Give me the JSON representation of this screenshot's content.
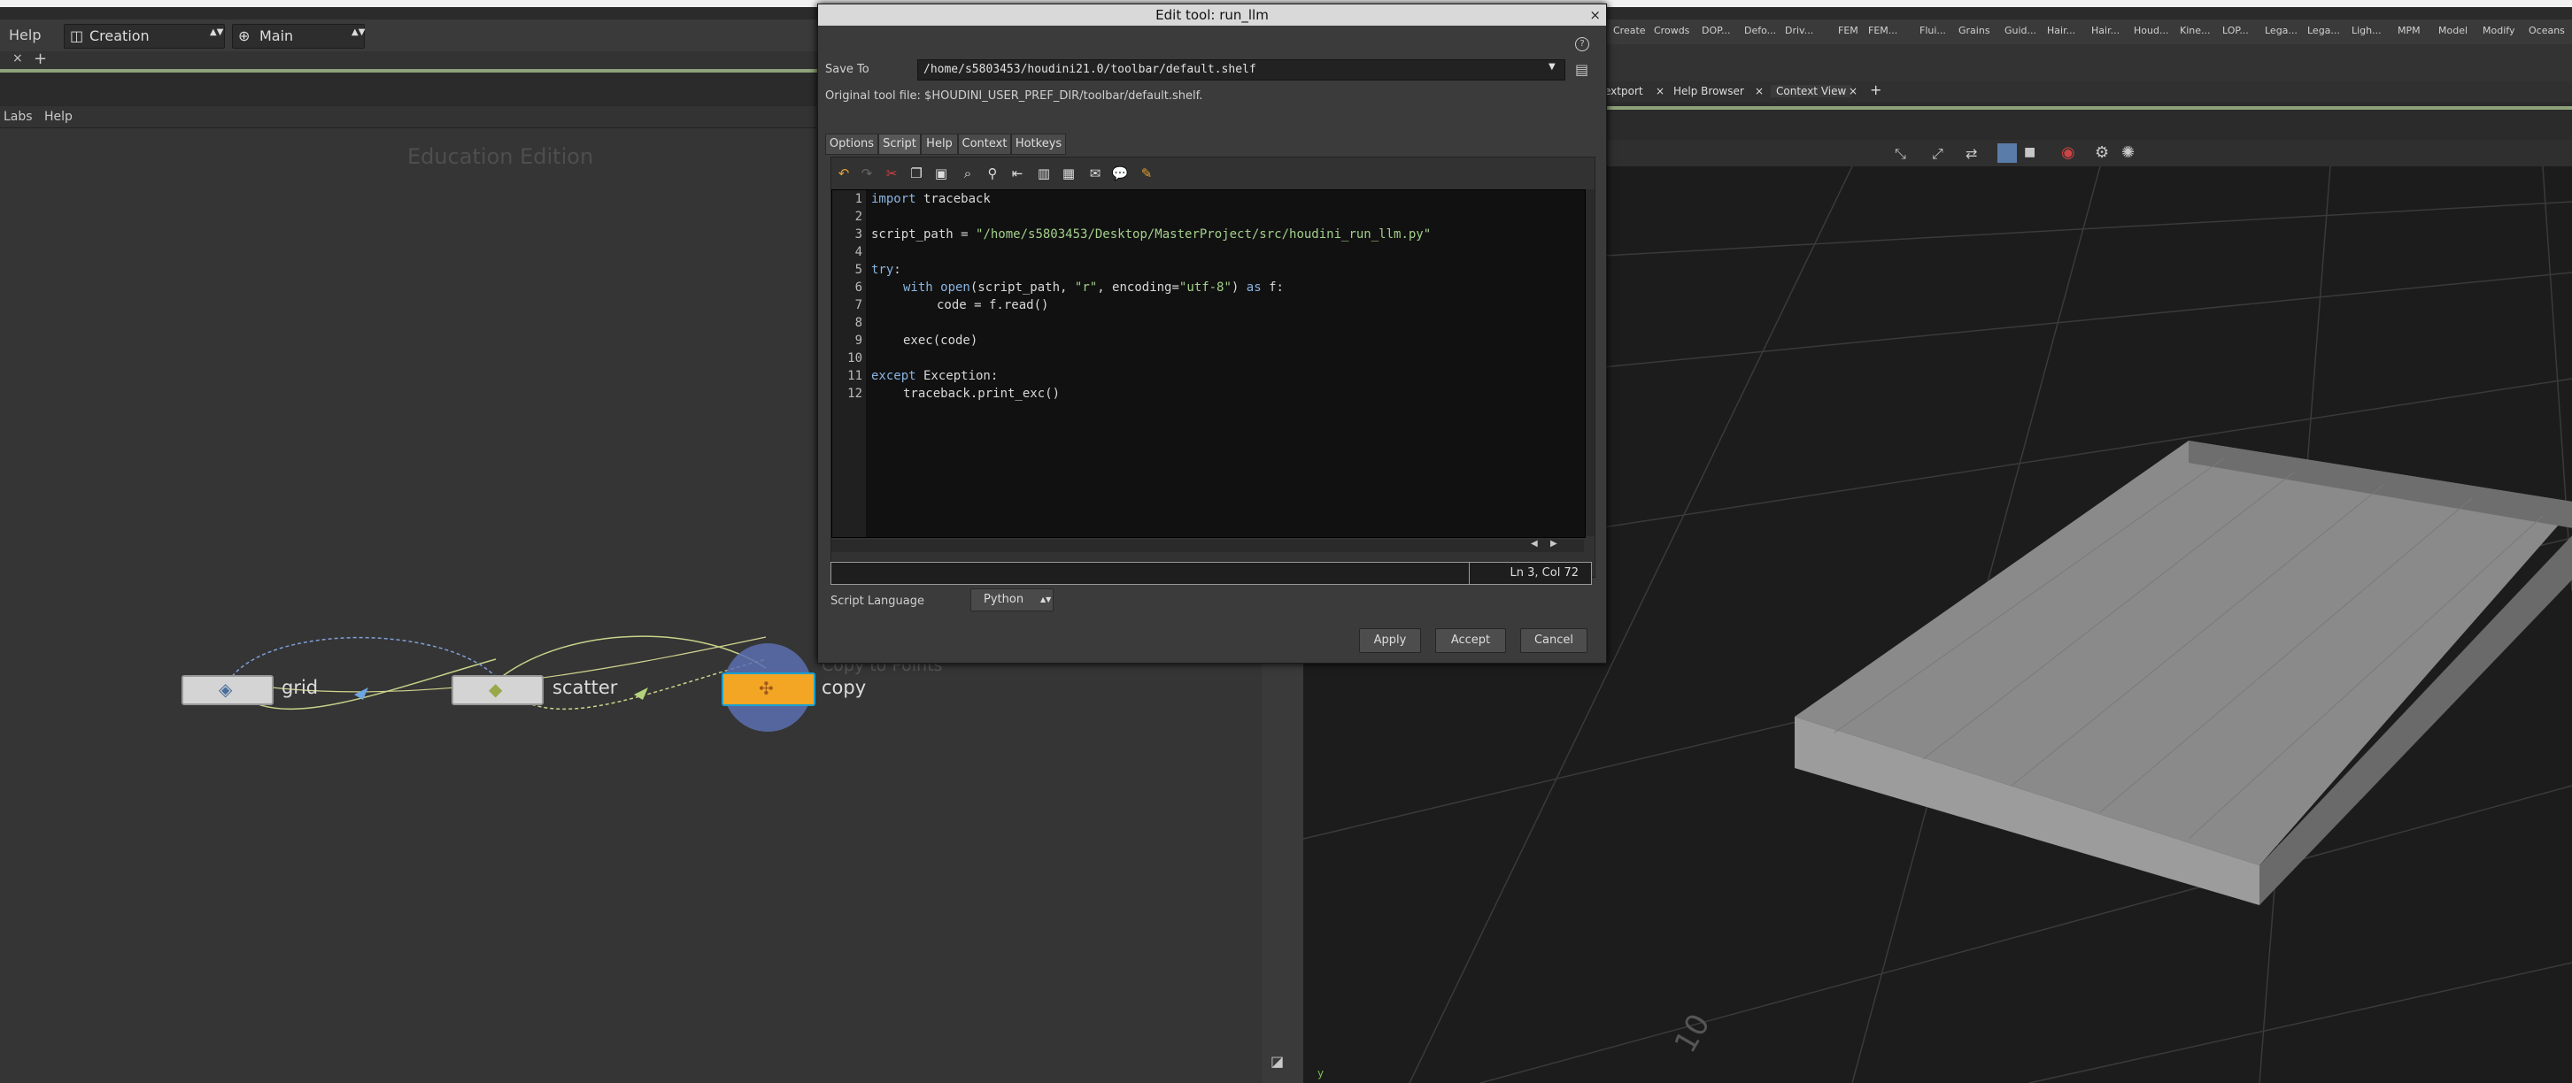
{
  "left_panel": {
    "menu_help": "Help",
    "desktop": "Creation",
    "context": "Main",
    "net_menu": [
      "Labs",
      "Help"
    ],
    "watermark": "Education Edition"
  },
  "network": {
    "nodes": [
      {
        "name": "grid",
        "label": "grid"
      },
      {
        "name": "scatter",
        "label": "scatter"
      },
      {
        "name": "copy",
        "label": "copy",
        "subtitle": "Copy to Points"
      }
    ]
  },
  "shelf_tabs": [
    "Create",
    "Crowds",
    "DOP...",
    "Defo...",
    "Driv...",
    "FEM",
    "FEM...",
    "Flui...",
    "Grains",
    "Guid...",
    "Hair...",
    "Hair...",
    "Houd...",
    "Kine...",
    "LOP...",
    "Lega...",
    "Lega...",
    "Ligh...",
    "MPM",
    "Model",
    "Modify",
    "Oceans"
  ],
  "pane_tabs": [
    "extport",
    "Help Browser",
    "Context View"
  ],
  "viewport": {
    "grid_label": "10",
    "axis_label": "y"
  },
  "dialog": {
    "title": "Edit tool: run_llm",
    "close": "×",
    "help_icon": "?",
    "save_to_label": "Save To",
    "save_to_value": "/home/s5803453/houdini21.0/toolbar/default.shelf",
    "original_file": "Original tool file: $HOUDINI_USER_PREF_DIR/toolbar/default.shelf.",
    "tabs": [
      "Options",
      "Script",
      "Help",
      "Context",
      "Hotkeys"
    ],
    "active_tab": "Script",
    "line_numbers": [
      "1",
      "2",
      "3",
      "4",
      "5",
      "6",
      "7",
      "8",
      "9",
      "10",
      "11",
      "12"
    ],
    "cursor_pos": "Ln 3, Col 72",
    "script_language_label": "Script Language",
    "script_language_value": "Python",
    "buttons": {
      "apply": "Apply",
      "accept": "Accept",
      "cancel": "Cancel"
    },
    "code": {
      "l1_kw": "import",
      "l1_rest": " traceback",
      "l3_a": "script_path = ",
      "l3_str": "\"/home/s5803453/Desktop/MasterProject/src/houdini_run_llm.py\"",
      "l5_kw": "try",
      "l5_rest": ":",
      "l6_kw": "with",
      "l6_fn": " open",
      "l6_a": "(script_path, ",
      "l6_s1": "\"r\"",
      "l6_b": ", encoding=",
      "l6_s2": "\"utf-8\"",
      "l6_c": ") ",
      "l6_kw2": "as",
      "l6_d": " f:",
      "l7": "code = f.read()",
      "l9": "exec(code)",
      "l11_kw": "except",
      "l11_rest": " Exception:",
      "l12": "traceback.print_exc()"
    }
  }
}
